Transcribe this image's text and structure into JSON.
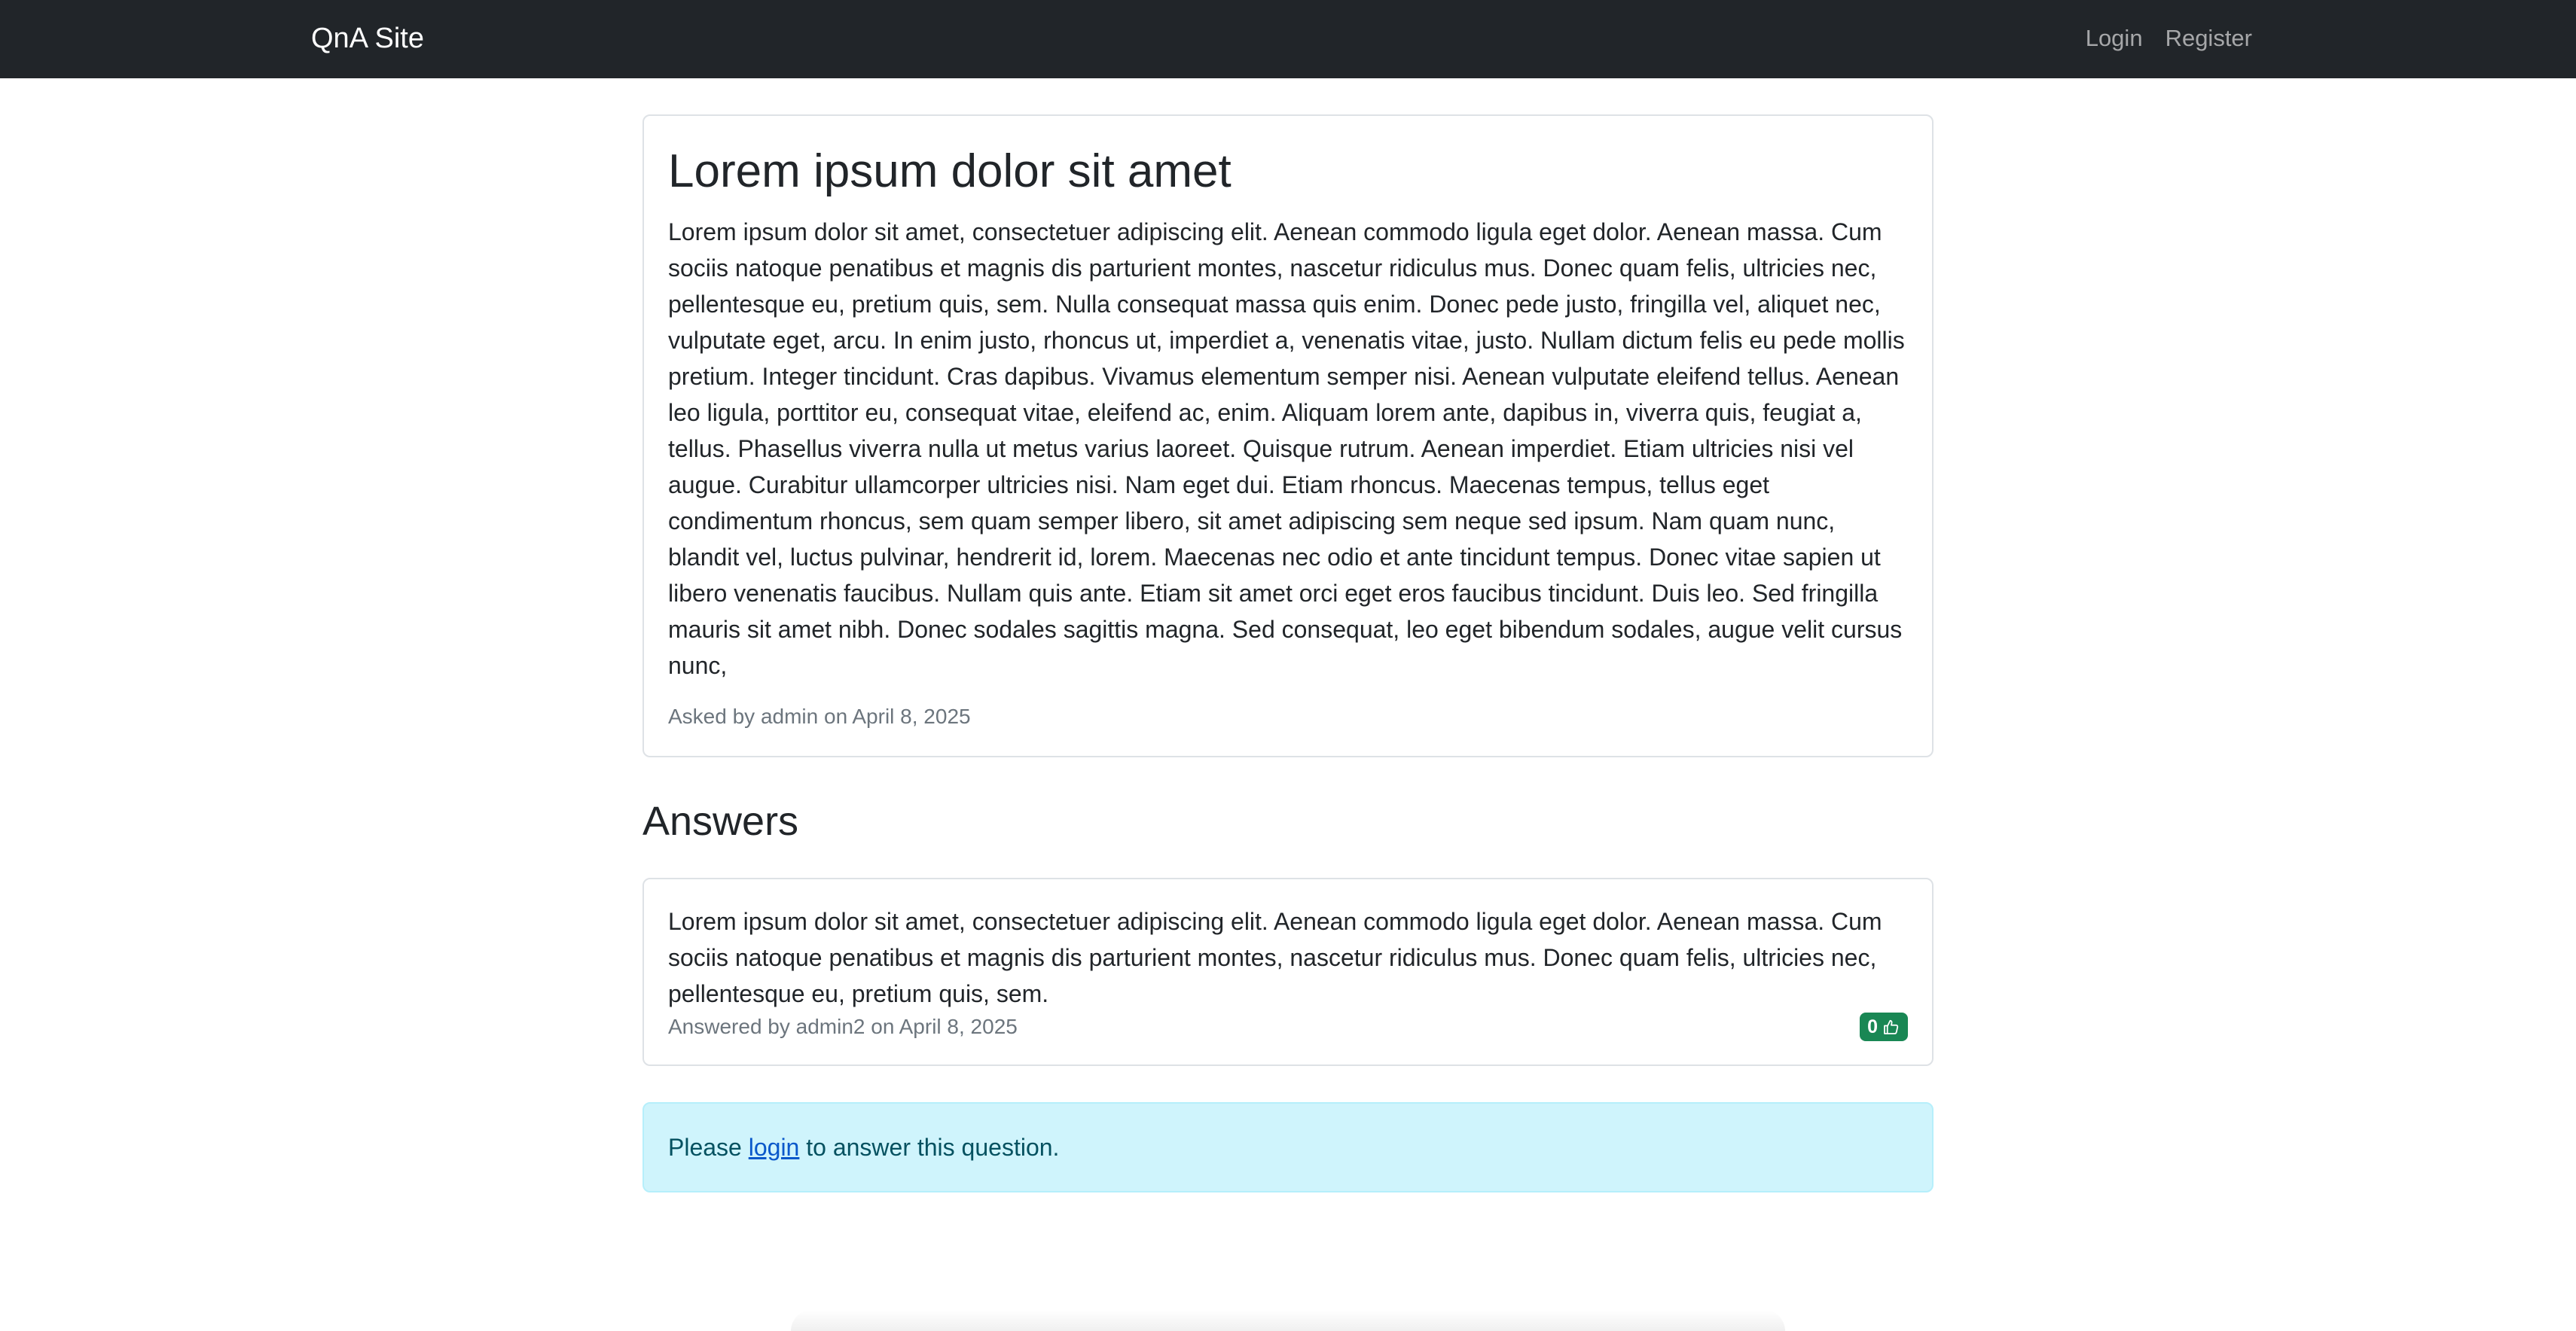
{
  "navbar": {
    "brand": "QnA Site",
    "links": [
      "Login",
      "Register"
    ]
  },
  "question": {
    "title": "Lorem ipsum dolor sit amet",
    "body": "Lorem ipsum dolor sit amet, consectetuer adipiscing elit. Aenean commodo ligula eget dolor. Aenean massa. Cum sociis natoque penatibus et magnis dis parturient montes, nascetur ridiculus mus. Donec quam felis, ultricies nec, pellentesque eu, pretium quis, sem. Nulla consequat massa quis enim. Donec pede justo, fringilla vel, aliquet nec, vulputate eget, arcu. In enim justo, rhoncus ut, imperdiet a, venenatis vitae, justo. Nullam dictum felis eu pede mollis pretium. Integer tincidunt. Cras dapibus. Vivamus elementum semper nisi. Aenean vulputate eleifend tellus. Aenean leo ligula, porttitor eu, consequat vitae, eleifend ac, enim. Aliquam lorem ante, dapibus in, viverra quis, feugiat a, tellus. Phasellus viverra nulla ut metus varius laoreet. Quisque rutrum. Aenean imperdiet. Etiam ultricies nisi vel augue. Curabitur ullamcorper ultricies nisi. Nam eget dui. Etiam rhoncus. Maecenas tempus, tellus eget condimentum rhoncus, sem quam semper libero, sit amet adipiscing sem neque sed ipsum. Nam quam nunc, blandit vel, luctus pulvinar, hendrerit id, lorem. Maecenas nec odio et ante tincidunt tempus. Donec vitae sapien ut libero venenatis faucibus. Nullam quis ante. Etiam sit amet orci eget eros faucibus tincidunt. Duis leo. Sed fringilla mauris sit amet nibh. Donec sodales sagittis magna. Sed consequat, leo eget bibendum sodales, augue velit cursus nunc,",
    "meta": "Asked by admin on April 8, 2025"
  },
  "answers": {
    "heading": "Answers",
    "items": [
      {
        "body": "Lorem ipsum dolor sit amet, consectetuer adipiscing elit. Aenean commodo ligula eget dolor. Aenean massa. Cum sociis natoque penatibus et magnis dis parturient montes, nascetur ridiculus mus. Donec quam felis, ultricies nec, pellentesque eu, pretium quis, sem.",
        "meta": "Answered by admin2 on April 8, 2025",
        "likes": "0",
        "like_icon": "thumbs-up-icon"
      }
    ]
  },
  "login_prompt": {
    "before": "Please ",
    "link": "login",
    "after": " to answer this question."
  },
  "colors": {
    "navbar_bg": "#212529",
    "like_button_bg": "#198754",
    "alert_bg": "#cff4fc",
    "link": "#0a58ca"
  }
}
